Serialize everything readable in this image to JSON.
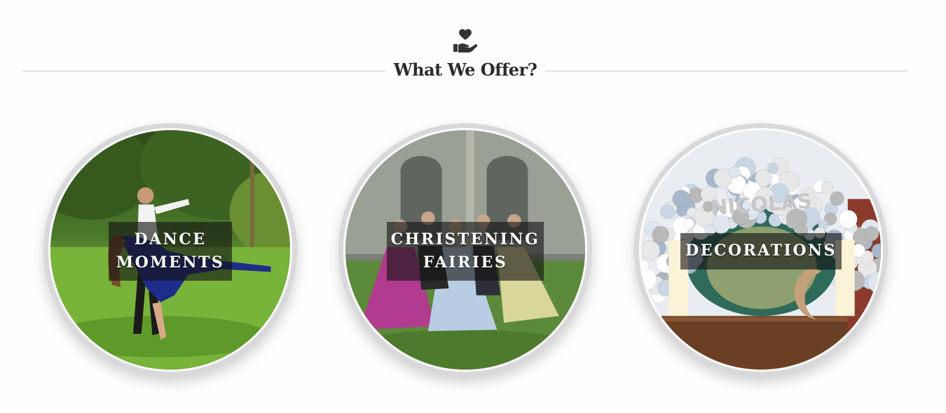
{
  "section": {
    "icon": "hand-holding-heart-icon",
    "title": "What We Offer?"
  },
  "offers": [
    {
      "label": "DANCE\nMOMENTS",
      "image": "couple-dancing-photo"
    },
    {
      "label": "CHRISTENING\nFAIRIES",
      "image": "girls-in-ball-gowns-photo"
    },
    {
      "label": "DECORATIONS",
      "image": "balloon-arch-decoration-photo"
    }
  ],
  "decoration_text": "NICOLAS",
  "colors": {
    "divider": "#c8c8c8",
    "title": "#2b2b2b",
    "label_overlay": "rgba(20,20,20,0.62)",
    "card_ring": "#d9d9db"
  }
}
